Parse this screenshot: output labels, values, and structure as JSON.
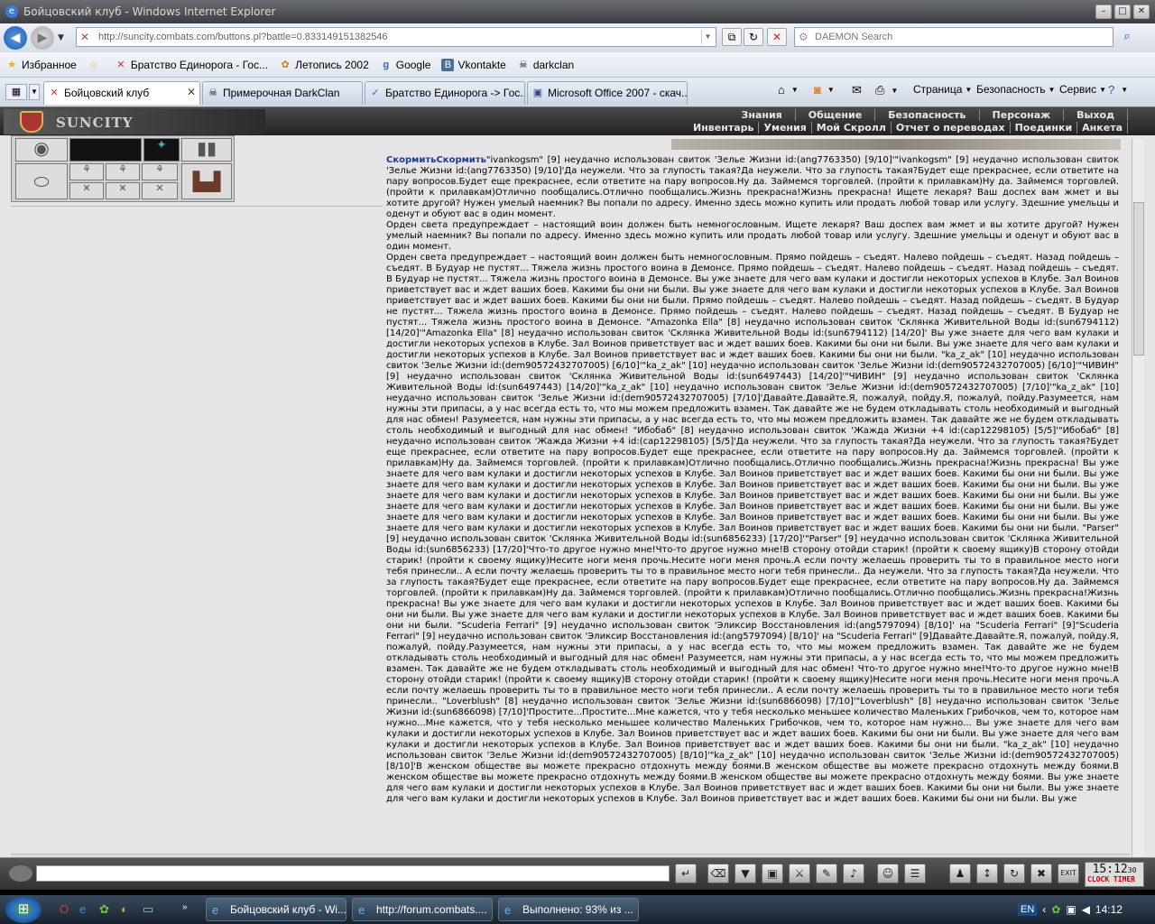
{
  "window": {
    "title": "Бойцовский клуб - Windows Internet Explorer"
  },
  "address": {
    "url": "http://suncity.combats.com/buttons.pl?battle=0.833149151382546"
  },
  "search": {
    "placeholder": "DAEMON Search"
  },
  "favorites": {
    "label": "Избранное",
    "items": [
      "Братство Единорога - Гос...",
      "Летопись 2002",
      "Google",
      "Vkontakte",
      "darkclan"
    ]
  },
  "tabs": [
    {
      "label": "Бойцовский клуб"
    },
    {
      "label": "Примерочная DarkClan"
    },
    {
      "label": "Братство Единорога -> Гос..."
    },
    {
      "label": "Microsoft Office 2007 - скач..."
    }
  ],
  "commandbar": {
    "page": "Страница",
    "safety": "Безопасность",
    "service": "Сервис"
  },
  "game": {
    "logo": "SUNCITY",
    "menu_top": [
      "Знания",
      "Общение",
      "Безопасность",
      "Персонаж",
      "Выход"
    ],
    "menu_bottom": [
      "Инвентарь",
      "Умения",
      "Мой Скролл",
      "Отчет о переводах",
      "Поединки",
      "Анкета"
    ]
  },
  "chat": {
    "nick": "СкормитьСкормить",
    "paragraphs": [
      "\"ivankogsm\" [9] неудачно использован свиток 'Зелье Жизни id:(ang7763350) [9/10]'\"ivankogsm\" [9] неудачно использован свиток 'Зелье Жизни id:(ang7763350) [9/10]'Да неужели. Что за глупость такая?Да неужели. Что за глупость такая?Будет еще прекраснее, если ответите на пару вопросов.Будет еще прекраснее, если ответите на пару вопросов.Ну да. Займемся торговлей. (пройти к прилавкам)Ну да. Займемся торговлей. (пройти к прилавкам)Отлично пообщались.Отлично пообщались.Жизнь прекрасна!Жизнь прекрасна! Ищете лекаря? Ваш доспех вам жмет и вы хотите другой? Нужен умелый наемник? Вы попали по адресу. Именно здесь можно купить или продать любой товар или услугу. Здешние умельцы и оденут и обуют вас в один момент.",
      "Орден света предупреждает – настоящий воин должен быть немногословным. Ищете лекаря? Ваш доспех вам жмет и вы хотите другой? Нужен умелый наемник? Вы попали по адресу. Именно здесь можно купить или продать любой товар или услугу. Здешние умельцы и оденут и обуют вас в один момент.",
      "Орден света предупреждает – настоящий воин должен быть немногословным. Прямо пойдешь – съедят. Налево пойдешь – съедят. Назад пойдешь – съедят. В Будуар не пустят... Тяжела жизнь простого воина в Демонсе. Прямо пойдешь – съедят. Налево пойдешь – съедят. Назад пойдешь – съедят. В Будуар не пустят... Тяжела жизнь простого воина в Демонсе. Вы уже знаете для чего вам кулаки и достигли некоторых успехов в Клубе. Зал Воинов приветствует вас и ждет ваших боев. Какими бы они ни были. Вы уже знаете для чего вам кулаки и достигли некоторых успехов в Клубе. Зал Воинов приветствует вас и ждет ваших боев. Какими бы они ни были. Прямо пойдешь – съедят. Налево пойдешь – съедят. Назад пойдешь – съедят. В Будуар не пустят... Тяжела жизнь простого воина в Демонсе. Прямо пойдешь – съедят. Налево пойдешь – съедят. Назад пойдешь – съедят. В Будуар не пустят... Тяжела жизнь простого воина в Демонсе. \"Amazonka Ella\" [8] неудачно использован свиток 'Склянка Живительной Воды id:(sun6794112) [14/20]'\"Amazonka Ella\" [8] неудачно использован свиток 'Склянка Живительной Воды id:(sun6794112) [14/20]' Вы уже знаете для чего вам кулаки и достигли некоторых успехов в Клубе. Зал Воинов приветствует вас и ждет ваших боев. Какими бы они ни были. Вы уже знаете для чего вам кулаки и достигли некоторых успехов в Клубе. Зал Воинов приветствует вас и ждет ваших боев. Какими бы они ни были. \"ka_z_ak\" [10] неудачно использован свиток 'Зелье Жизни id:(dem90572432707005) [6/10]'\"ka_z_ak\" [10] неудачно использован свиток 'Зелье Жизни id:(dem90572432707005) [6/10]'\"ЧИВИН\" [9] неудачно использован свиток 'Склянка Живительной Воды id:(sun6497443) [14/20]'\"ЧИВИН\" [9] неудачно использован свиток 'Склянка Живительной Воды id:(sun6497443) [14/20]'\"ka_z_ak\" [10] неудачно использован свиток 'Зелье Жизни id:(dem90572432707005) [7/10]'\"ka_z_ak\" [10] неудачно использован свиток 'Зелье Жизни id:(dem90572432707005) [7/10]'Давайте.Давайте.Я, пожалуй, пойду.Я, пожалуй, пойду.Разумеется, нам нужны эти припасы, а у нас всегда есть то, что мы можем предложить взамен. Так давайте же не будем откладывать столь необходимый и выгодный для нас обмен! Разумеется, нам нужны эти припасы, а у нас всегда есть то, что мы можем предложить взамен. Так давайте же не будем откладывать столь необходимый и выгодный для нас обмен! \"Ибобаб\" [8] неудачно использован свиток 'Жажда Жизни +4 id:(cap12298105) [5/5]'\"Ибобаб\" [8] неудачно использован свиток 'Жажда Жизни +4 id:(cap12298105) [5/5]'Да неужели. Что за глупость такая?Да неужели. Что за глупость такая?Будет еще прекраснее, если ответите на пару вопросов.Будет еще прекраснее, если ответите на пару вопросов.Ну да. Займемся торговлей. (пройти к прилавкам)Ну да. Займемся торговлей. (пройти к прилавкам)Отлично пообщались.Отлично пообщались.Жизнь прекрасна!Жизнь прекрасна! Вы уже знаете для чего вам кулаки и достигли некоторых успехов в Клубе. Зал Воинов приветствует вас и ждет ваших боев. Какими бы они ни были. Вы уже знаете для чего вам кулаки и достигли некоторых успехов в Клубе. Зал Воинов приветствует вас и ждет ваших боев. Какими бы они ни были. Вы уже знаете для чего вам кулаки и достигли некоторых успехов в Клубе. Зал Воинов приветствует вас и ждет ваших боев. Какими бы они ни были. Вы уже знаете для чего вам кулаки и достигли некоторых успехов в Клубе. Зал Воинов приветствует вас и ждет ваших боев. Какими бы они ни были. Вы уже знаете для чего вам кулаки и достигли некоторых успехов в Клубе. Зал Воинов приветствует вас и ждет ваших боев. Какими бы они ни были. Вы уже знаете для чего вам кулаки и достигли некоторых успехов в Клубе. Зал Воинов приветствует вас и ждет ваших боев. Какими бы они ни были. \"Parser\" [9] неудачно использован свиток 'Склянка Живительной Воды id:(sun6856233) [17/20]'\"Parser\" [9] неудачно использован свиток 'Склянка Живительной Воды id:(sun6856233) [17/20]'Что-то другое нужно мне!Что-то другое нужно мне!В сторону отойди старик! (пройти к своему ящику)В сторону отойди старик! (пройти к своему ящику)Несите ноги меня прочь.Несите ноги меня прочь.А если почту желаешь проверить ты то в правильное место ноги тебя принесли.. А если почту желаешь проверить ты то в правильное место ноги тебя принесли.. Да неужели. Что за глупость такая?Да неужели. Что за глупость такая?Будет еще прекраснее, если ответите на пару вопросов.Будет еще прекраснее, если ответите на пару вопросов.Ну да. Займемся торговлей. (пройти к прилавкам)Ну да. Займемся торговлей. (пройти к прилавкам)Отлично пообщались.Отлично пообщались.Жизнь прекрасна!Жизнь прекрасна! Вы уже знаете для чего вам кулаки и достигли некоторых успехов в Клубе. Зал Воинов приветствует вас и ждет ваших боев. Какими бы они ни были. Вы уже знаете для чего вам кулаки и достигли некоторых успехов в Клубе. Зал Воинов приветствует вас и ждет ваших боев. Какими бы они ни были. \"Scuderia Ferrari\" [9] неудачно использован свиток 'Эликсир Восстановления id:(ang5797094) [8/10]' на \"Scuderia Ferrari\" [9]\"Scuderia Ferrari\" [9] неудачно использован свиток 'Эликсир Восстановления id:(ang5797094) [8/10]' на \"Scuderia Ferrari\" [9]Давайте.Давайте.Я, пожалуй, пойду.Я, пожалуй, пойду.Разумеется, нам нужны эти припасы, а у нас всегда есть то, что мы можем предложить взамен. Так давайте же не будем откладывать столь необходимый и выгодный для нас обмен! Разумеется, нам нужны эти припасы, а у нас всегда есть то, что мы можем предложить взамен. Так давайте же не будем откладывать столь необходимый и выгодный для нас обмен! Что-то другое нужно мне!Что-то другое нужно мне!В сторону отойди старик! (пройти к своему ящику)В сторону отойди старик! (пройти к своему ящику)Несите ноги меня прочь.Несите ноги меня прочь.А если почту желаешь проверить ты то в правильное место ноги тебя принесли.. А если почту желаешь проверить ты то в правильное место ноги тебя принесли.. \"Loverblush\" [8] неудачно использован свиток 'Зелье Жизни id:(sun6866098) [7/10]'\"Loverblush\" [8] неудачно использован свиток 'Зелье Жизни id:(sun6866098) [7/10]'Простите...Простите...Мне кажется, что у тебя несколько меньшее количество Маленьких Грибочков, чем то, которое нам нужно...Мне кажется, что у тебя несколько меньшее количество Маленьких Грибочков, чем то, которое нам нужно... Вы уже знаете для чего вам кулаки и достигли некоторых успехов в Клубе. Зал Воинов приветствует вас и ждет ваших боев. Какими бы они ни были. Вы уже знаете для чего вам кулаки и достигли некоторых успехов в Клубе. Зал Воинов приветствует вас и ждет ваших боев. Какими бы они ни были. \"ka_z_ak\" [10] неудачно использован свиток 'Зелье Жизни id:(dem90572432707005) [8/10]'\"ka_z_ak\" [10] неудачно использован свиток 'Зелье Жизни id:(dem90572432707005) [8/10]'В женском обществе вы можете прекрасно отдохнуть между боями.В женском обществе вы можете прекрасно отдохнуть между боями.В женском обществе вы можете прекрасно отдохнуть между боями.В женском обществе вы можете прекрасно отдохнуть между боями. Вы уже знаете для чего вам кулаки и достигли некоторых успехов в Клубе. Зал Воинов приветствует вас и ждет ваших боев. Какими бы они ни были. Вы уже знаете для чего вам кулаки и достигли некоторых успехов в Клубе. Зал Воинов приветствует вас и ждет ваших боев. Какими бы они ни были. Вы уже"
    ]
  },
  "clock": {
    "time": "15:12",
    "seconds": "30",
    "label": "CLOCK TIMER"
  },
  "taskbar": {
    "items": [
      "Бойцовский клуб - Wi...",
      "http://forum.combats....",
      "Выполнено: 93% из ..."
    ],
    "lang": "EN",
    "time": "14:12"
  }
}
